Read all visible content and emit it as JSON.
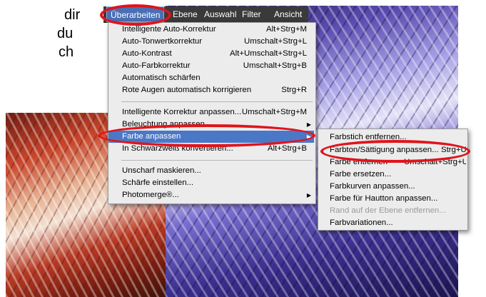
{
  "page_text": {
    "line1": "dir",
    "line2": "du",
    "line3": "ch"
  },
  "menubar": {
    "items": [
      "Überarbeiten",
      "Ebene",
      "Auswahl",
      "Filter",
      "Ansicht"
    ]
  },
  "menu": {
    "items": [
      {
        "label": "Intelligente Auto-Korrektur",
        "shortcut": "Alt+Strg+M"
      },
      {
        "label": "Auto-Tonwertkorrektur",
        "shortcut": "Umschalt+Strg+L"
      },
      {
        "label": "Auto-Kontrast",
        "shortcut": "Alt+Umschalt+Strg+L"
      },
      {
        "label": "Auto-Farbkorrektur",
        "shortcut": "Umschalt+Strg+B"
      },
      {
        "label": "Automatisch schärfen",
        "shortcut": ""
      },
      {
        "label": "Rote Augen automatisch korrigieren",
        "shortcut": "Strg+R"
      },
      {
        "label": "Intelligente Korrektur anpassen...",
        "shortcut": "Umschalt+Strg+M"
      },
      {
        "label": "Beleuchtung anpassen",
        "shortcut": ""
      },
      {
        "label": "Farbe anpassen",
        "shortcut": ""
      },
      {
        "label": "In Schwarzweiß konvertieren...",
        "shortcut": "Alt+Strg+B"
      },
      {
        "label": "Unscharf maskieren...",
        "shortcut": ""
      },
      {
        "label": "Schärfe einstellen...",
        "shortcut": ""
      },
      {
        "label": "Photomerge®...",
        "shortcut": ""
      }
    ]
  },
  "submenu": {
    "items": [
      {
        "label": "Farbstich entfernen...",
        "shortcut": ""
      },
      {
        "label": "Farbton/Sättigung anpassen...",
        "shortcut": "Strg+U"
      },
      {
        "label": "Farbe entfernen",
        "shortcut": "Umschalt+Strg+U"
      },
      {
        "label": "Farbe ersetzen...",
        "shortcut": ""
      },
      {
        "label": "Farbkurven anpassen...",
        "shortcut": ""
      },
      {
        "label": "Farbe für Hautton anpassen...",
        "shortcut": ""
      },
      {
        "label": "Rand auf der Ebene entfernen...",
        "shortcut": ""
      },
      {
        "label": "Farbvariationen...",
        "shortcut": ""
      }
    ]
  },
  "colors": {
    "annotation": "#e0141c",
    "highlight": "#4a78c7",
    "menubar": "#3a3a3a"
  }
}
